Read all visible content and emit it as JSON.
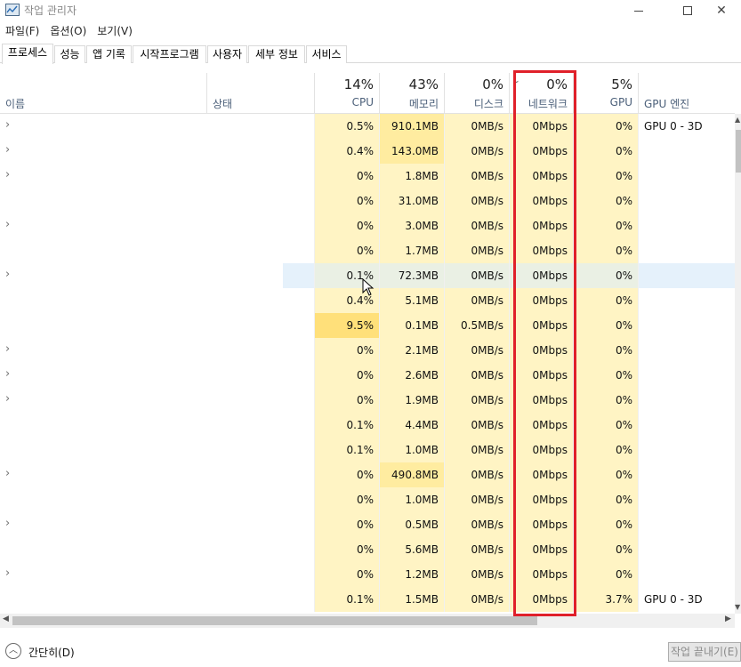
{
  "window": {
    "title": "작업 관리자",
    "minimize_icon": "minimize-icon",
    "maximize_icon": "maximize-icon",
    "close_icon": "close-icon"
  },
  "menu": [
    "파일(F)",
    "옵션(O)",
    "보기(V)"
  ],
  "tabs": [
    "프로세스",
    "성능",
    "앱 기록",
    "시작프로그램",
    "사용자",
    "세부 정보",
    "서비스"
  ],
  "active_tab": "프로세스",
  "columns": {
    "name": {
      "label": "이름"
    },
    "status": {
      "label": "상태"
    },
    "cpu": {
      "pct": "14%",
      "label": "CPU"
    },
    "memory": {
      "pct": "43%",
      "label": "메모리"
    },
    "disk": {
      "pct": "0%",
      "label": "디스크"
    },
    "network": {
      "pct": "0%",
      "label": "네트워크"
    },
    "gpu": {
      "pct": "5%",
      "label": "GPU"
    },
    "gpu_engine": {
      "label": "GPU 엔진"
    }
  },
  "rows": [
    {
      "expand": true,
      "cpu": "0.5%",
      "mem": "910.1MB",
      "disk": "0MB/s",
      "net": "0Mbps",
      "gpu": "0%",
      "gpu_engine": "GPU 0 - 3D"
    },
    {
      "expand": true,
      "cpu": "0.4%",
      "mem": "143.0MB",
      "disk": "0MB/s",
      "net": "0Mbps",
      "gpu": "0%",
      "gpu_engine": ""
    },
    {
      "expand": true,
      "cpu": "0%",
      "mem": "1.8MB",
      "disk": "0MB/s",
      "net": "0Mbps",
      "gpu": "0%",
      "gpu_engine": ""
    },
    {
      "expand": false,
      "cpu": "0%",
      "mem": "31.0MB",
      "disk": "0MB/s",
      "net": "0Mbps",
      "gpu": "0%",
      "gpu_engine": ""
    },
    {
      "expand": true,
      "cpu": "0%",
      "mem": "3.0MB",
      "disk": "0MB/s",
      "net": "0Mbps",
      "gpu": "0%",
      "gpu_engine": ""
    },
    {
      "expand": false,
      "cpu": "0%",
      "mem": "1.7MB",
      "disk": "0MB/s",
      "net": "0Mbps",
      "gpu": "0%",
      "gpu_engine": ""
    },
    {
      "expand": true,
      "cpu": "0.1%",
      "mem": "72.3MB",
      "disk": "0MB/s",
      "net": "0Mbps",
      "gpu": "0%",
      "gpu_engine": "",
      "selected": true
    },
    {
      "expand": false,
      "cpu": "0.4%",
      "mem": "5.1MB",
      "disk": "0MB/s",
      "net": "0Mbps",
      "gpu": "0%",
      "gpu_engine": ""
    },
    {
      "expand": false,
      "cpu": "9.5%",
      "mem": "0.1MB",
      "disk": "0.5MB/s",
      "net": "0Mbps",
      "gpu": "0%",
      "gpu_engine": ""
    },
    {
      "expand": true,
      "cpu": "0%",
      "mem": "2.1MB",
      "disk": "0MB/s",
      "net": "0Mbps",
      "gpu": "0%",
      "gpu_engine": ""
    },
    {
      "expand": true,
      "cpu": "0%",
      "mem": "2.6MB",
      "disk": "0MB/s",
      "net": "0Mbps",
      "gpu": "0%",
      "gpu_engine": ""
    },
    {
      "expand": true,
      "cpu": "0%",
      "mem": "1.9MB",
      "disk": "0MB/s",
      "net": "0Mbps",
      "gpu": "0%",
      "gpu_engine": ""
    },
    {
      "expand": false,
      "cpu": "0.1%",
      "mem": "4.4MB",
      "disk": "0MB/s",
      "net": "0Mbps",
      "gpu": "0%",
      "gpu_engine": ""
    },
    {
      "expand": false,
      "cpu": "0.1%",
      "mem": "1.0MB",
      "disk": "0MB/s",
      "net": "0Mbps",
      "gpu": "0%",
      "gpu_engine": ""
    },
    {
      "expand": true,
      "cpu": "0%",
      "mem": "490.8MB",
      "disk": "0MB/s",
      "net": "0Mbps",
      "gpu": "0%",
      "gpu_engine": ""
    },
    {
      "expand": false,
      "cpu": "0%",
      "mem": "1.0MB",
      "disk": "0MB/s",
      "net": "0Mbps",
      "gpu": "0%",
      "gpu_engine": ""
    },
    {
      "expand": true,
      "cpu": "0%",
      "mem": "0.5MB",
      "disk": "0MB/s",
      "net": "0Mbps",
      "gpu": "0%",
      "gpu_engine": ""
    },
    {
      "expand": false,
      "cpu": "0%",
      "mem": "5.6MB",
      "disk": "0MB/s",
      "net": "0Mbps",
      "gpu": "0%",
      "gpu_engine": ""
    },
    {
      "expand": true,
      "cpu": "0%",
      "mem": "1.2MB",
      "disk": "0MB/s",
      "net": "0Mbps",
      "gpu": "0%",
      "gpu_engine": ""
    },
    {
      "expand": false,
      "cpu": "0.1%",
      "mem": "1.5MB",
      "disk": "0MB/s",
      "net": "0Mbps",
      "gpu": "3.7%",
      "gpu_engine": "GPU 0 - 3D"
    }
  ],
  "footer": {
    "collapse_label": "간단히(D)",
    "end_task_label": "작업 끝내기(E)"
  },
  "colors": {
    "heat_light": "#fff4c4",
    "heat_mid": "#ffeca0",
    "heat_strong": "#ffe07a",
    "selection": "#e5f1fb",
    "highlight_box": "#e0202a",
    "header_label": "#4c607a"
  }
}
